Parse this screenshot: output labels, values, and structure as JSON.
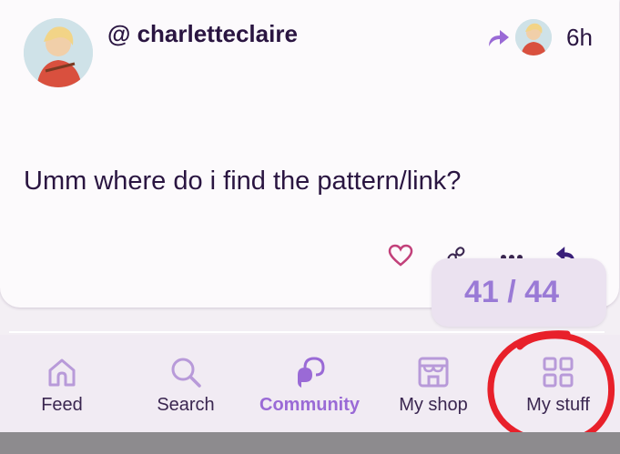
{
  "post": {
    "username": "@ charletteclaire",
    "time": "6h",
    "message": "Umm where do i find the pattern/link?"
  },
  "page_counter": "41 / 44",
  "tabbar": {
    "items": [
      {
        "label": "Feed",
        "icon": "home-icon"
      },
      {
        "label": "Search",
        "icon": "search-icon"
      },
      {
        "label": "Community",
        "icon": "community-icon",
        "active": true
      },
      {
        "label": "My shop",
        "icon": "shop-icon"
      },
      {
        "label": "My stuff",
        "icon": "grid-icon"
      }
    ]
  },
  "colors": {
    "accent": "#9a6ad6",
    "text": "#2a1541",
    "heart": "#c2407a",
    "annotation": "#e8202a"
  }
}
